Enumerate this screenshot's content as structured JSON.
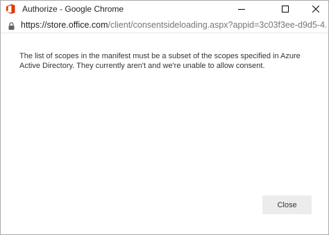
{
  "window": {
    "title": "Authorize - Google Chrome",
    "app_icon": "office-icon",
    "controls": [
      "minimize-icon",
      "maximize-icon",
      "close-icon"
    ]
  },
  "address_bar": {
    "lock_icon": "lock-icon",
    "url_host": "https://store.office.com",
    "url_path": "/client/consentsideloading.aspx?appid=3c03f3ee-d9d5-4..."
  },
  "dialog": {
    "message": "The list of scopes in the manifest must be a subset of the scopes specified in Azure Active Directory. They currently aren't and we're unable to allow consent.",
    "close_label": "Close"
  },
  "colors": {
    "office_brand": "#d83b01",
    "button_background": "#ececec",
    "text": "#333333"
  }
}
